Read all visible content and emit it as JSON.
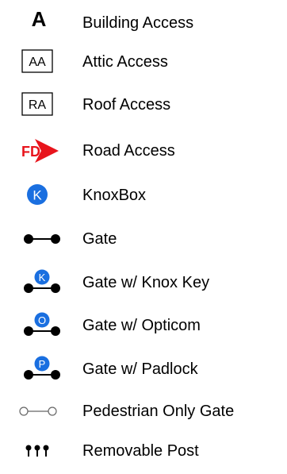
{
  "legend": {
    "items": [
      {
        "label": "Building Access",
        "symbol": "building-access-icon",
        "glyph": "A"
      },
      {
        "label": "Attic Access",
        "symbol": "attic-access-icon",
        "glyph": "AA"
      },
      {
        "label": "Roof Access",
        "symbol": "roof-access-icon",
        "glyph": "RA"
      },
      {
        "label": "Road Access",
        "symbol": "road-access-icon",
        "glyph": "FD"
      },
      {
        "label": "KnoxBox",
        "symbol": "knoxbox-icon",
        "glyph": "K"
      },
      {
        "label": "Gate",
        "symbol": "gate-icon"
      },
      {
        "label": "Gate w/ Knox Key",
        "symbol": "gate-knox-key-icon",
        "glyph": "K"
      },
      {
        "label": "Gate w/ Opticom",
        "symbol": "gate-opticom-icon",
        "glyph": "O"
      },
      {
        "label": "Gate w/ Padlock",
        "symbol": "gate-padlock-icon",
        "glyph": "P"
      },
      {
        "label": "Pedestrian Only Gate",
        "symbol": "pedestrian-gate-icon"
      },
      {
        "label": "Removable Post",
        "symbol": "removable-post-icon"
      }
    ]
  },
  "colors": {
    "text": "#000000",
    "fd_red": "#e8141c",
    "knox_blue": "#1a6fe0",
    "pedestrian_gray": "#666666"
  }
}
